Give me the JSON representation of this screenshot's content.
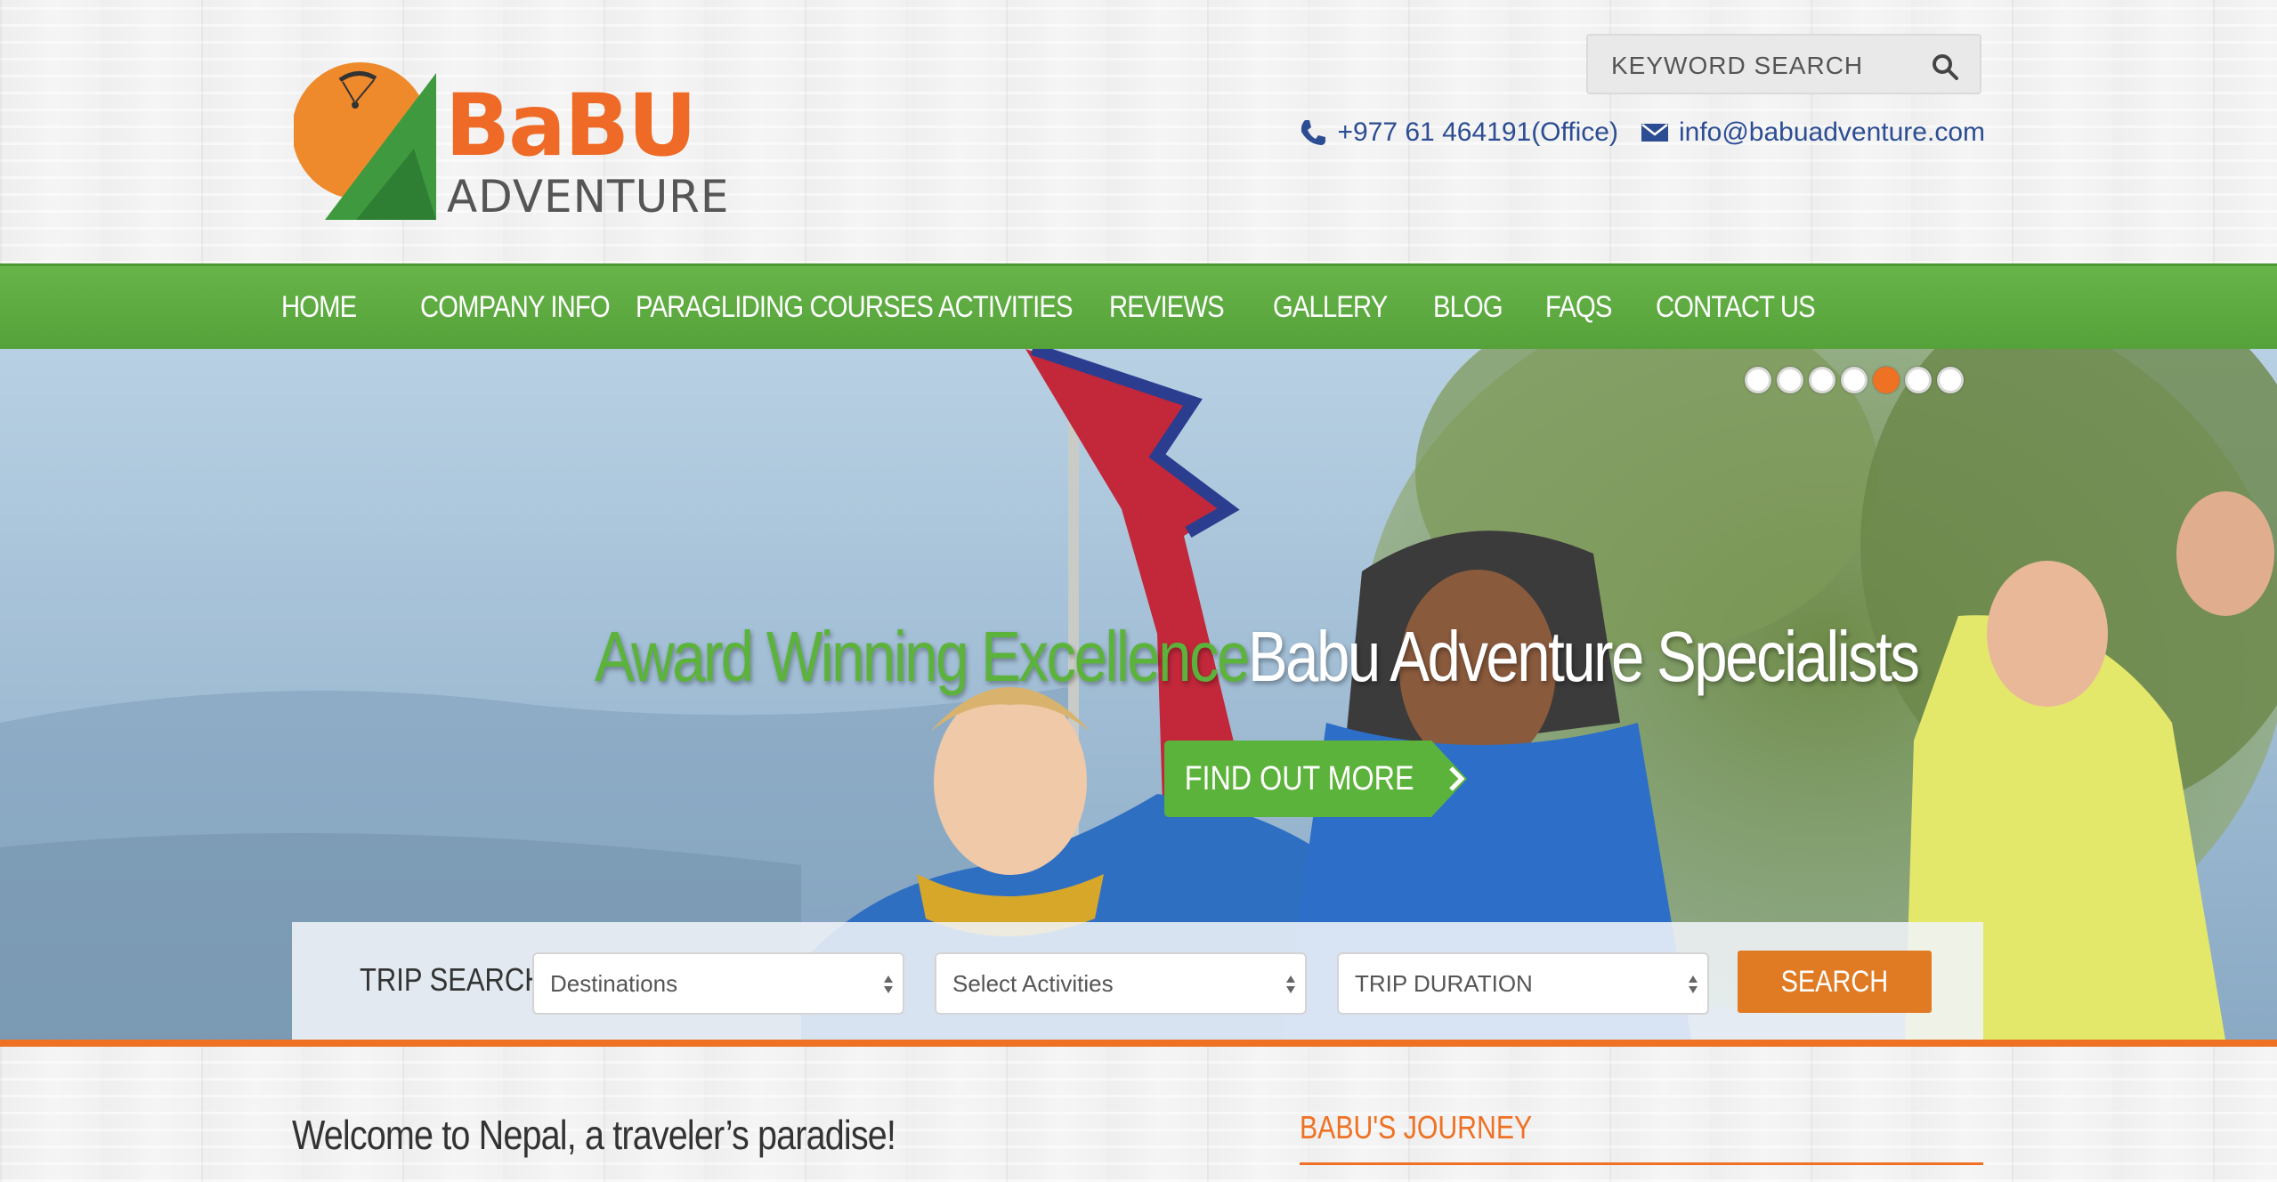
{
  "header": {
    "logo": {
      "word_top": "BaBU",
      "word_bottom": "ADVENTURE"
    },
    "search": {
      "placeholder": "KEYWORD SEARCH"
    },
    "contact": {
      "phone": "+977 61 464191(Office)",
      "email": "info@babuadventure.com"
    }
  },
  "nav": {
    "items": [
      {
        "label": "HOME",
        "dropdown": false
      },
      {
        "label": "COMPANY INFO",
        "dropdown": true
      },
      {
        "label": "PARAGLIDING COURSES",
        "dropdown": true
      },
      {
        "label": "ACTIVITIES",
        "dropdown": true
      },
      {
        "label": "REVIEWS",
        "dropdown": true
      },
      {
        "label": "GALLERY",
        "dropdown": true
      },
      {
        "label": "BLOG",
        "dropdown": false
      },
      {
        "label": "FAQS",
        "dropdown": false
      },
      {
        "label": "CONTACT US",
        "dropdown": false
      }
    ]
  },
  "hero": {
    "slides_total": 7,
    "active_slide": 5,
    "headline_green": "Award Winning Excellence",
    "headline_white": "Babu Adventure Specialists",
    "cta": "FIND OUT MORE"
  },
  "trip_search": {
    "label": "TRIP SEARCH",
    "destinations": "Destinations",
    "activities": "Select Activities",
    "duration": "TRIP DURATION",
    "button": "SEARCH"
  },
  "content": {
    "welcome": "Welcome to Nepal, a traveler’s paradise!",
    "sidebar_title": "BABU'S JOURNEY"
  },
  "colors": {
    "brand_green": "#5cb33b",
    "brand_orange": "#ef7124",
    "link_blue": "#2c4d93",
    "search_button": "#e07b24"
  }
}
